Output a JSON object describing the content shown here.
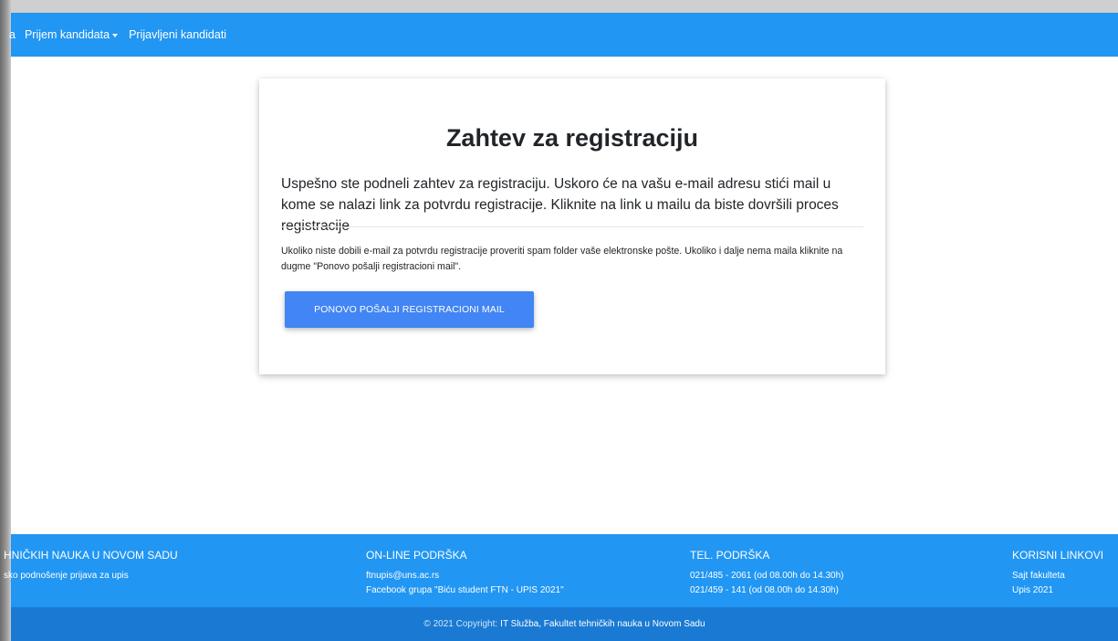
{
  "navbar": {
    "items": [
      {
        "label": "a"
      },
      {
        "label": "Prijem kandidata",
        "has_dropdown": true
      },
      {
        "label": "Prijavljeni kandidati"
      }
    ]
  },
  "card": {
    "title": "Zahtev za registraciju",
    "lead": "Uspešno ste podneli zahtev za registraciju. Uskoro će na vašu e-mail adresu stići mail u kome se nalazi link za potvrdu registracije. Kliknite na link u mailu da biste dovršili proces registracije",
    "note": "Ukoliko niste dobili e-mail za potvrdu registracije proveriti spam folder vaše elektronske pošte. Ukoliko i dalje nema maila kliknite na dugme \"Ponovo pošalji registracioni mail\".",
    "button_label": "PONOVO POŠALJI REGISTRACIONI MAIL"
  },
  "footer": {
    "col1": {
      "heading": "HNIČKIH NAUKA U NOVOM SADU",
      "line1": "sko podnošenje prijava za upis"
    },
    "col2": {
      "heading": "ON-LINE PODRŠKA",
      "line1": "ftnupis@uns.ac.rs",
      "line2": "Facebook grupa \"Biću student FTN - UPIS 2021\""
    },
    "col3": {
      "heading": "TEL. PODRŠKA",
      "line1": "021/485 - 2061 (od 08.00h do 14.30h)",
      "line2": "021/459 - 141 (od 08.00h do 14.30h)"
    },
    "col4": {
      "heading": "KORISNI LINKOVI",
      "line1": "Sajt fakulteta",
      "line2": "Upis 2021"
    },
    "copyright_prefix": "© 2021 Copyright:",
    "copyright_link": "IT Služba, Fakultet tehničkih nauka u Novom Sadu"
  },
  "colors": {
    "navbar": "#2196f3",
    "button": "#4285f4",
    "footer_bottom": "#1a7ad3"
  }
}
